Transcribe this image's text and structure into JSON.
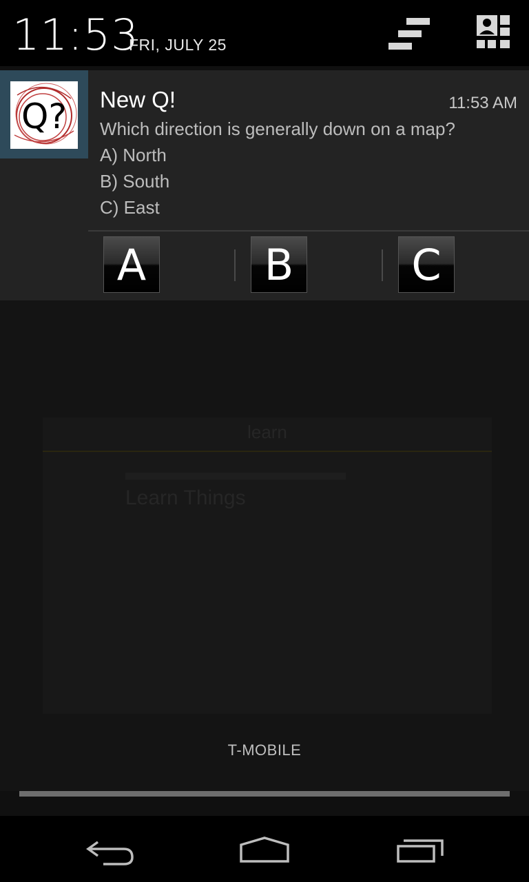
{
  "status": {
    "time": "11:53",
    "date": "FRI, JULY 25"
  },
  "header_icons": {
    "clear": "clear-all-icon",
    "settings": "quick-settings-icon"
  },
  "notification": {
    "app_icon_text": "Q?",
    "title": "New Q!",
    "time": "11:53 AM",
    "question": "Which direction is generally down on a map?",
    "options": [
      "A) North",
      "B) South",
      "C) East"
    ],
    "actions": [
      "A",
      "B",
      "C"
    ]
  },
  "background_app": {
    "title": "learn",
    "row_title": "Learn Things"
  },
  "carrier": "T-MOBILE",
  "navbar": {
    "back": "back-icon",
    "home": "home-icon",
    "recents": "recents-icon"
  },
  "colors": {
    "header_bg": "#000000",
    "notification_bg": "#232323",
    "icon_box_bg": "#2e4a5a",
    "icon_accent": "#b02a2a"
  }
}
